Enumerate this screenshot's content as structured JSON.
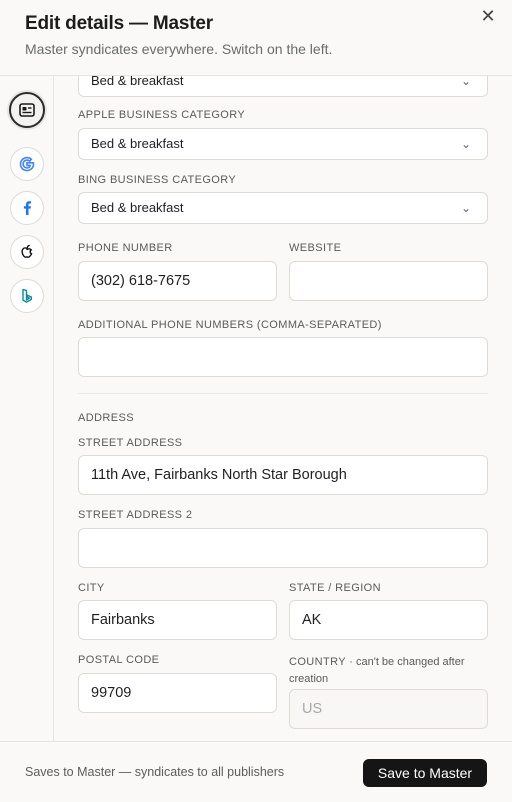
{
  "header": {
    "title": "Edit details — Master",
    "subtitle": "Master syndicates everywhere. Switch on the left.",
    "close_glyph": "✕"
  },
  "rail": {
    "items": [
      {
        "name": "master",
        "icon": "id-card-icon"
      },
      {
        "name": "google",
        "icon": "google-icon"
      },
      {
        "name": "facebook",
        "icon": "facebook-icon"
      },
      {
        "name": "apple",
        "icon": "apple-icon"
      },
      {
        "name": "bing",
        "icon": "bing-icon"
      }
    ],
    "active": "master"
  },
  "form": {
    "top_category": {
      "value": "Bed & breakfast"
    },
    "apple_category": {
      "label": "Apple Business Category",
      "value": "Bed & breakfast"
    },
    "bing_category": {
      "label": "Bing Business Category",
      "value": "Bed & breakfast"
    },
    "phone": {
      "label": "Phone Number",
      "value": "(302) 618-7675"
    },
    "website": {
      "label": "Website",
      "value": ""
    },
    "additional_phones": {
      "label": "Additional Phone Numbers (comma-separated)",
      "value": ""
    },
    "address_section": "Address",
    "street": {
      "label": "Street Address",
      "value": "11th Ave, Fairbanks North Star Borough"
    },
    "street2": {
      "label": "Street Address 2",
      "value": ""
    },
    "city": {
      "label": "City",
      "value": "Fairbanks"
    },
    "state": {
      "label": "State / Region",
      "value": "AK"
    },
    "postal": {
      "label": "Postal Code",
      "value": "99709"
    },
    "country": {
      "label": "Country",
      "note": "· can't be changed after creation",
      "value": "US"
    }
  },
  "footer": {
    "note": "Saves to Master — syndicates to all publishers",
    "save_label": "Save to Master"
  },
  "colors": {
    "primary_button": "#151515",
    "google_blue": "#4285f4",
    "facebook_blue": "#1877f2",
    "bing_teal": "#0a8a9a"
  }
}
